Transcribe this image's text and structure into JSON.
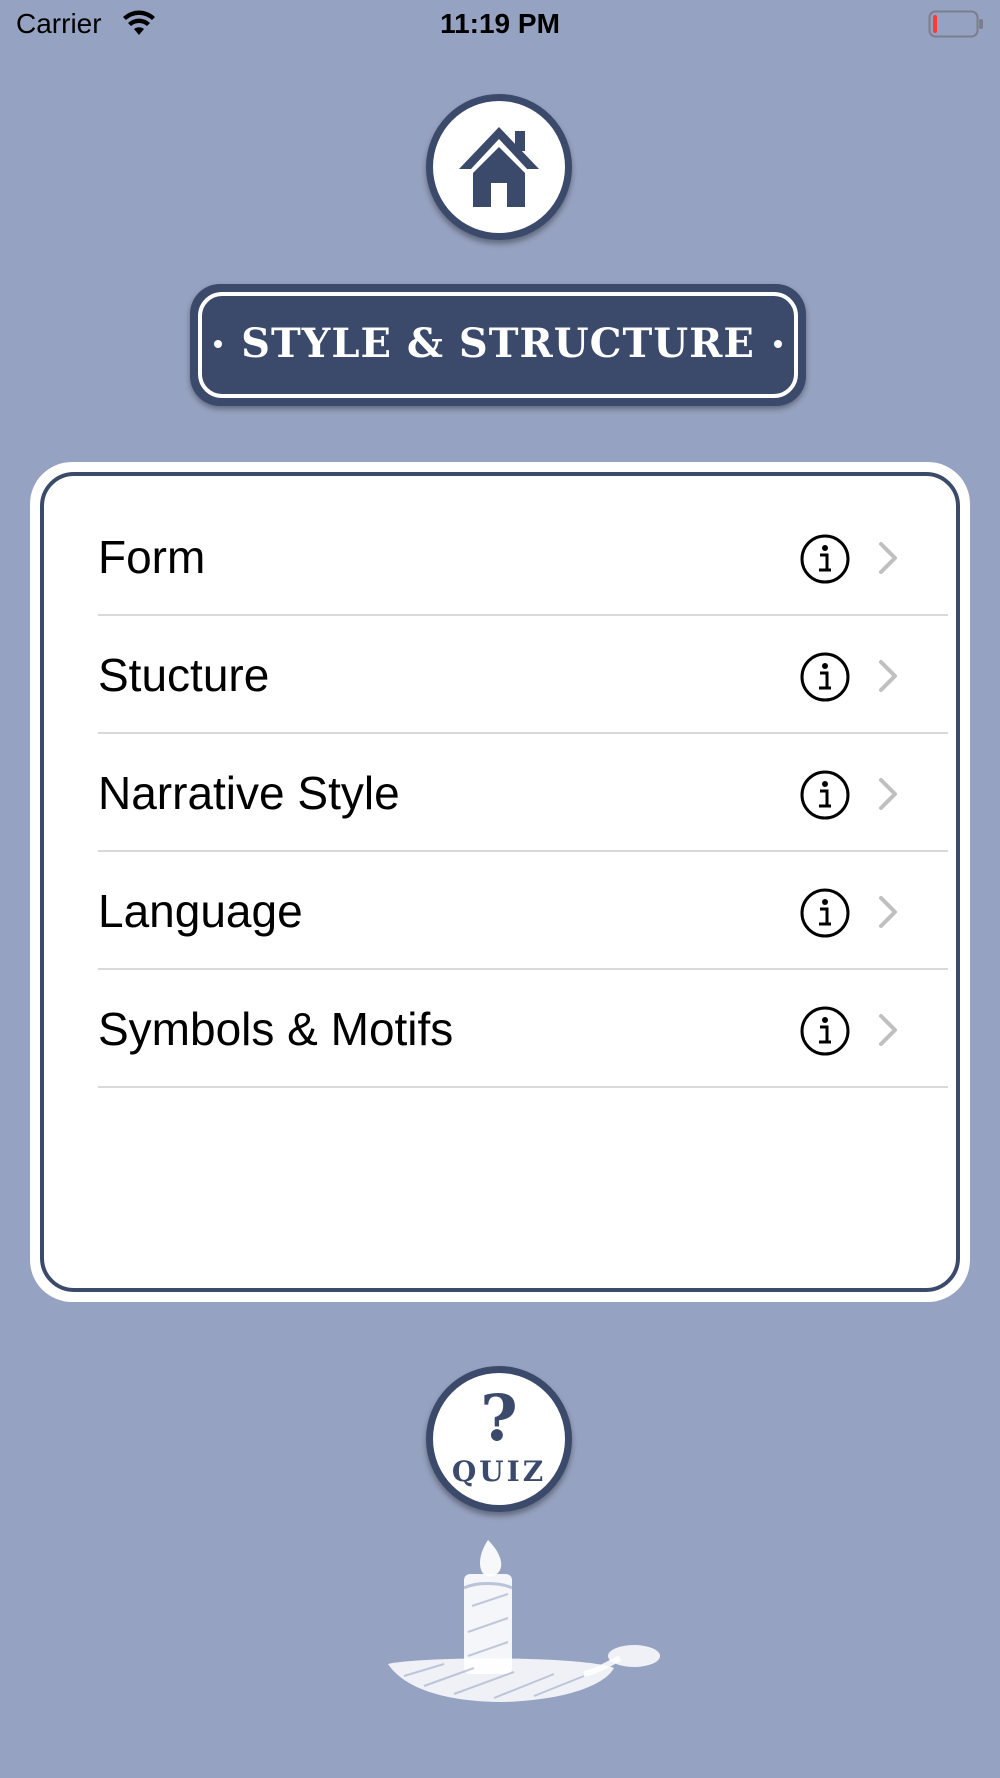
{
  "status_bar": {
    "carrier": "Carrier",
    "time": "11:19 PM",
    "wifi_icon": "wifi-icon",
    "battery_icon": "battery-low-icon",
    "battery_level_fraction": 0.05
  },
  "header": {
    "home_icon": "home-icon",
    "title": "STYLE & STRUCTURE"
  },
  "menu": {
    "items": [
      {
        "label": "Form",
        "info_icon": "info-icon",
        "chevron_icon": "chevron-right-icon"
      },
      {
        "label": "Stucture",
        "info_icon": "info-icon",
        "chevron_icon": "chevron-right-icon"
      },
      {
        "label": "Narrative Style",
        "info_icon": "info-icon",
        "chevron_icon": "chevron-right-icon"
      },
      {
        "label": "Language",
        "info_icon": "info-icon",
        "chevron_icon": "chevron-right-icon"
      },
      {
        "label": "Symbols & Motifs",
        "info_icon": "info-icon",
        "chevron_icon": "chevron-right-icon"
      }
    ]
  },
  "quiz": {
    "mark": "?",
    "label": "QUIZ"
  },
  "decoration": {
    "illustration": "candle-icon"
  },
  "colors": {
    "background": "#96a2c1",
    "navy": "#3b4a6b",
    "card": "#ffffff",
    "divider": "#d9d9d9",
    "chevron": "#c0c0c0",
    "battery_red": "#ff3b30"
  }
}
